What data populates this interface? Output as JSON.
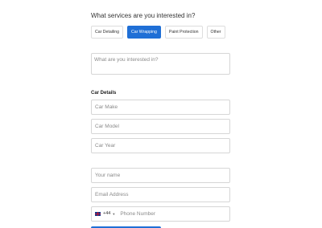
{
  "services": {
    "question": "What services are you interested in?",
    "options": [
      {
        "label": "Car Detailing",
        "selected": false
      },
      {
        "label": "Car Wrapping",
        "selected": true
      },
      {
        "label": "Paint Protection",
        "selected": false
      },
      {
        "label": "Other",
        "selected": false
      }
    ],
    "interest_placeholder": "What are you interested in?"
  },
  "car_details": {
    "title": "Car Details",
    "make_placeholder": "Car Make",
    "model_placeholder": "Car Model",
    "year_placeholder": "Car Year"
  },
  "contact": {
    "name_placeholder": "Your name",
    "email_placeholder": "Email Address",
    "dial_code": "+44",
    "phone_placeholder": "Phone Number"
  },
  "colors": {
    "accent": "#1f6fd6",
    "border": "#d6d6d6"
  },
  "icons": {
    "country_flag": "uk-flag-icon",
    "dropdown": "chevron-down-icon"
  }
}
